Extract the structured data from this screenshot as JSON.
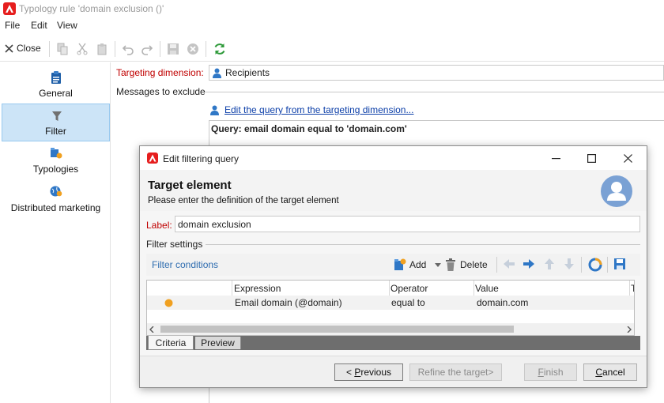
{
  "window": {
    "title": "Typology rule 'domain exclusion ()'"
  },
  "menu": {
    "file": "File",
    "edit": "Edit",
    "view": "View"
  },
  "toolbar": {
    "close_label": "Close"
  },
  "nav": [
    {
      "label": "General",
      "icon": "clipboard-icon"
    },
    {
      "label": "Filter",
      "icon": "filter-icon"
    },
    {
      "label": "Typologies",
      "icon": "typology-icon"
    },
    {
      "label": "Distributed marketing",
      "icon": "globe-icon"
    }
  ],
  "form": {
    "targeting_dimension_label": "Targeting dimension:",
    "targeting_dimension_value": "Recipients",
    "messages_to_exclude": "Messages to exclude",
    "edit_query_link": "Edit the query from the targeting dimension...",
    "query_text": "Query: email domain equal to 'domain.com'"
  },
  "dialog": {
    "title": "Edit filtering query",
    "heading": "Target element",
    "subheading": "Please enter the definition of the target element",
    "label_caption": "Label:",
    "label_value": "domain exclusion",
    "filter_settings": "Filter settings",
    "filter_conditions": "Filter conditions",
    "add_label": "Add",
    "delete_label": "Delete",
    "table": {
      "columns": [
        "Expression",
        "Operator",
        "Value",
        "Ta"
      ],
      "rows": [
        {
          "expression": "Email domain (@domain)",
          "operator": "equal to",
          "value": "domain.com"
        }
      ]
    },
    "tabs": [
      "Criteria",
      "Preview"
    ],
    "buttons": {
      "previous": "< Previous",
      "refine": "Refine the target>",
      "finish": "Finish",
      "cancel": "Cancel"
    }
  },
  "colors": {
    "accent_red": "#c00000",
    "link": "#0b3ea8",
    "selection": "#cce4f7",
    "status_dot": "#f0a020"
  }
}
